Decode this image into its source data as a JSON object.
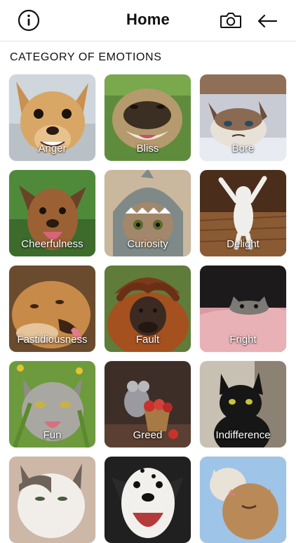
{
  "header": {
    "title": "Home",
    "info_icon": "info-circle-icon",
    "camera_icon": "camera-icon",
    "back_icon": "arrow-left-icon"
  },
  "section": {
    "title": "CATEGORY OF EMOTIONS"
  },
  "categories": [
    {
      "label": "Anger",
      "image": "angry-chihuahua"
    },
    {
      "label": "Bliss",
      "image": "happy-pug-in-grass"
    },
    {
      "label": "Bore",
      "image": "grumpy-cat-in-bed"
    },
    {
      "label": "Cheerfulness",
      "image": "cheerful-dog"
    },
    {
      "label": "Curiosity",
      "image": "cat-in-shark-hat"
    },
    {
      "label": "Delight",
      "image": "cat-standing-arms-up"
    },
    {
      "label": "Fastidiousness",
      "image": "lioness-sticking-tongue"
    },
    {
      "label": "Fault",
      "image": "orangutan-covering-head"
    },
    {
      "label": "Fright",
      "image": "cat-peeking-under-blanket"
    },
    {
      "label": "Fun",
      "image": "cat-laughing-in-grass"
    },
    {
      "label": "Greed",
      "image": "rat-with-apple-basket"
    },
    {
      "label": "Indifference",
      "image": "black-cat"
    },
    {
      "label": "",
      "image": "white-grey-cat"
    },
    {
      "label": "",
      "image": "dalmatian-wide-mouth"
    },
    {
      "label": "",
      "image": "kittens-licking"
    }
  ],
  "colors": {
    "divider": "#e3e3e3",
    "label_text": "#ffffff"
  }
}
